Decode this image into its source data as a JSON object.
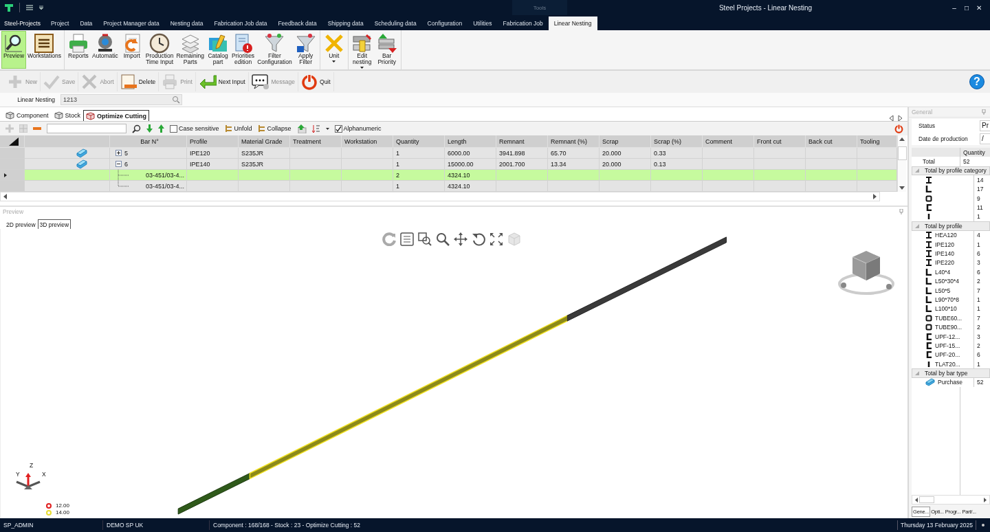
{
  "window": {
    "title": "Steel Projects - Linear Nesting",
    "context_label": "Tools",
    "controls": [
      "–",
      "□",
      "✕"
    ]
  },
  "menu_tabs": [
    {
      "label": "Steel-Projects",
      "selected": false
    },
    {
      "label": "Project",
      "selected": false
    },
    {
      "label": "Data",
      "selected": false
    },
    {
      "label": "Project Manager data",
      "selected": false
    },
    {
      "label": "Nesting data",
      "selected": false
    },
    {
      "label": "Fabrication Job data",
      "selected": false
    },
    {
      "label": "Feedback data",
      "selected": false
    },
    {
      "label": "Shipping data",
      "selected": false
    },
    {
      "label": "Scheduling data",
      "selected": false
    },
    {
      "label": "Configuration",
      "selected": false
    },
    {
      "label": "Utilities",
      "selected": false
    },
    {
      "label": "Fabrication Job",
      "selected": false
    },
    {
      "label": "Linear Nesting",
      "selected": true
    }
  ],
  "ribbon": [
    {
      "buttons": [
        {
          "lines": [
            "Preview"
          ],
          "selected": true
        },
        {
          "lines": [
            "Workstations"
          ],
          "selected": false
        }
      ]
    },
    {
      "buttons": [
        {
          "lines": [
            "Reports"
          ],
          "selected": false
        },
        {
          "lines": [
            "Automatic"
          ],
          "selected": false
        },
        {
          "lines": [
            "Import"
          ],
          "selected": false
        },
        {
          "lines": [
            "Production",
            "Time Input"
          ],
          "selected": false
        },
        {
          "lines": [
            "Remaining",
            "Parts"
          ],
          "selected": false
        },
        {
          "lines": [
            "Catalog",
            "part"
          ],
          "selected": false
        },
        {
          "lines": [
            "Priorities",
            "edition"
          ],
          "selected": false
        },
        {
          "lines": [
            "Filter",
            "Configuration"
          ],
          "selected": false
        },
        {
          "lines": [
            "Apply",
            "Filter"
          ],
          "selected": false
        }
      ]
    },
    {
      "buttons": [
        {
          "lines": [
            "Unit"
          ],
          "selected": false,
          "dropdown": true
        }
      ]
    },
    {
      "buttons": [
        {
          "lines": [
            "Edit",
            "nesting"
          ],
          "selected": false,
          "dropdown": true
        },
        {
          "lines": [
            "Bar",
            "Priority"
          ],
          "selected": false
        }
      ]
    }
  ],
  "toolbar": [
    {
      "label": "New",
      "disabled": true
    },
    {
      "label": "Save",
      "disabled": true
    },
    {
      "label": "Abort",
      "disabled": true
    },
    {
      "label": "Delete",
      "disabled": false
    },
    {
      "label": "Print",
      "disabled": true
    },
    {
      "label": "Next Input",
      "disabled": false
    },
    {
      "label": "Message",
      "disabled": true
    },
    {
      "label": "Quit",
      "disabled": false
    }
  ],
  "help": "?",
  "linear_nesting": {
    "label": "Linear Nesting",
    "value": "1213"
  },
  "tabs": [
    {
      "label": "Component",
      "selected": false
    },
    {
      "label": "Stock",
      "selected": false
    },
    {
      "label": "Optimize Cutting",
      "selected": true
    }
  ],
  "grid_toolbar": {
    "case_sensitive": {
      "label": "Case sensitive",
      "checked": false
    },
    "unfold": "Unfold",
    "collapse": "Collapse",
    "alphanumeric": {
      "label": "Alphanumeric",
      "checked": true
    }
  },
  "table": {
    "columns": [
      "Bar N°",
      "Profile",
      "Material Grade",
      "Treatment",
      "Workstation",
      "Quantity",
      "Length",
      "Remnant",
      "Remnant (%)",
      "Scrap",
      "Scrap (%)",
      "Comment",
      "Front cut",
      "Back cut",
      "Tooling"
    ],
    "rows": [
      {
        "bar_no": "5",
        "profile": "IPE120",
        "material_grade": "S235JR",
        "quantity": "1",
        "length": "6000.00",
        "remnant": "3941.898",
        "remnant_pct": "65.70",
        "scrap": "20.000",
        "scrap_pct": "0.33",
        "expanded": false,
        "selected": false
      },
      {
        "bar_no": "6",
        "profile": "IPE140",
        "material_grade": "S235JR",
        "quantity": "1",
        "length": "15000.00",
        "remnant": "2001.700",
        "remnant_pct": "13.34",
        "scrap": "20.000",
        "scrap_pct": "0.13",
        "expanded": true,
        "selected": false,
        "children": [
          {
            "bar_no": "03-451/03-4...",
            "quantity": "2",
            "length": "4324.10",
            "selected": true
          },
          {
            "bar_no": "03-451/03-4...",
            "quantity": "1",
            "length": "4324.10",
            "selected": false
          }
        ]
      }
    ]
  },
  "preview": {
    "title": "Preview",
    "tabs": [
      {
        "label": "2D preview",
        "selected": false
      },
      {
        "label": "3D preview",
        "selected": true
      }
    ],
    "axis_labels": {
      "x": "X",
      "y": "Y",
      "z": "Z"
    },
    "legend": [
      {
        "value": "12.00",
        "color": "#e02020"
      },
      {
        "value": "14.00",
        "color": "#e8dc30"
      }
    ]
  },
  "general": {
    "title": "General",
    "status": {
      "label": "Status",
      "value": "Pr"
    },
    "date": {
      "label": "Date de production",
      "value": "/"
    },
    "quantity_header": "Quantity",
    "total": {
      "label": "Total",
      "quantity": "52"
    },
    "groups": [
      {
        "label": "Total by profile category",
        "expanded": true,
        "children": [
          {
            "kind": "i-beam",
            "quantity": "14"
          },
          {
            "kind": "angle",
            "quantity": "17"
          },
          {
            "kind": "tube",
            "quantity": "9"
          },
          {
            "kind": "channel",
            "quantity": "11"
          },
          {
            "kind": "flat",
            "quantity": "1"
          }
        ]
      },
      {
        "label": "Total by profile",
        "expanded": true,
        "children": [
          {
            "kind": "i-beam",
            "name": "HEA120",
            "quantity": "4"
          },
          {
            "kind": "i-beam",
            "name": "IPE120",
            "quantity": "1"
          },
          {
            "kind": "i-beam",
            "name": "IPE140",
            "quantity": "6"
          },
          {
            "kind": "i-beam",
            "name": "IPE220",
            "quantity": "3"
          },
          {
            "kind": "angle",
            "name": "L40*4",
            "quantity": "6"
          },
          {
            "kind": "angle",
            "name": "L50*30*4",
            "quantity": "2"
          },
          {
            "kind": "angle",
            "name": "L50*5",
            "quantity": "7"
          },
          {
            "kind": "angle",
            "name": "L90*70*8",
            "quantity": "1"
          },
          {
            "kind": "angle",
            "name": "L100*10",
            "quantity": "1"
          },
          {
            "kind": "tube",
            "name": "TUBE60...",
            "quantity": "7"
          },
          {
            "kind": "tube",
            "name": "TUBE90...",
            "quantity": "2"
          },
          {
            "kind": "channel",
            "name": "UPF-12...",
            "quantity": "3"
          },
          {
            "kind": "channel",
            "name": "UPF-15...",
            "quantity": "2"
          },
          {
            "kind": "channel",
            "name": "UPF-20...",
            "quantity": "6"
          },
          {
            "kind": "flat",
            "name": "TLAT20...",
            "quantity": "1"
          }
        ]
      },
      {
        "label": "Total by bar type",
        "expanded": true,
        "children": [
          {
            "kind": "bar",
            "name": "Purchase",
            "quantity": "52"
          }
        ]
      }
    ],
    "bottom_tabs": [
      {
        "label": "Gene...",
        "selected": true
      },
      {
        "label": "Opti...",
        "selected": false
      },
      {
        "label": "Progr...",
        "selected": false
      },
      {
        "label": "Part/...",
        "selected": false
      }
    ]
  },
  "status_bar": {
    "user": "SP_ADMIN",
    "database": "DEMO SP UK",
    "summary": "Component : 168/168 - Stock : 23 - Optimize Cutting : 52",
    "date": "Thursday 13 February 2025"
  }
}
